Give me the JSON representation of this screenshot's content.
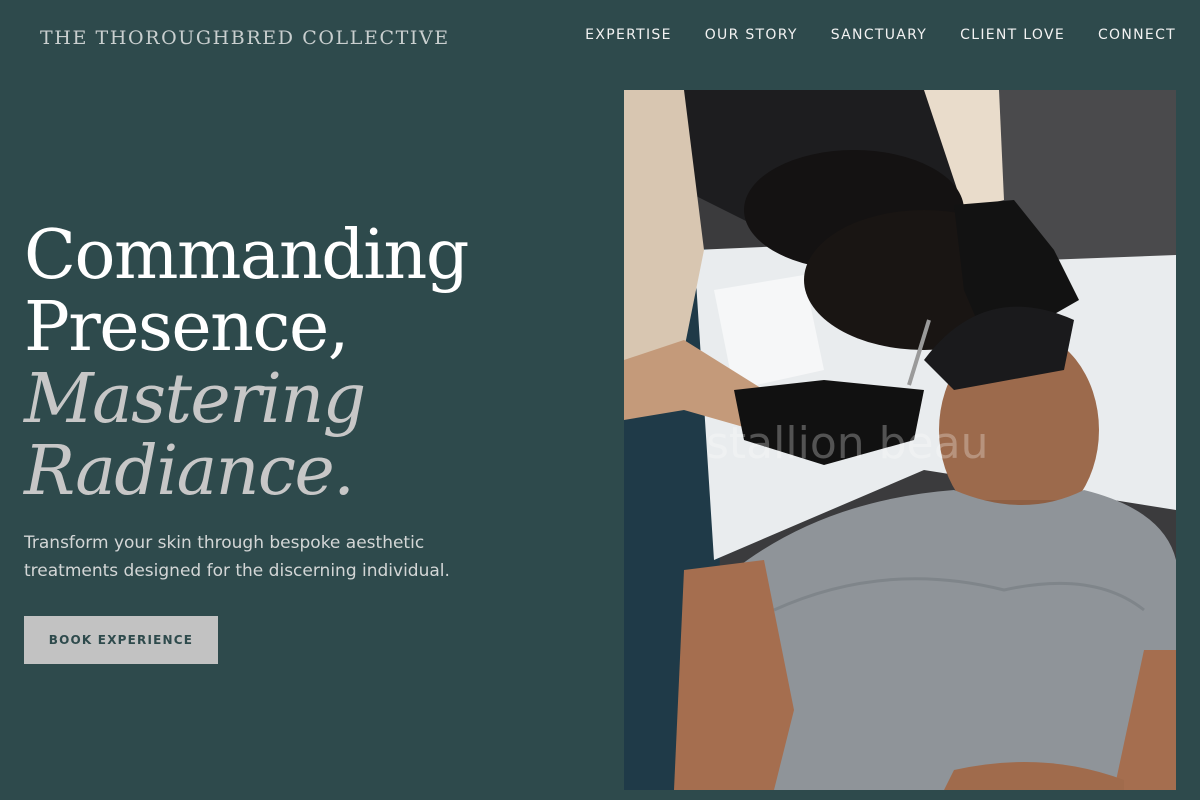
{
  "header": {
    "brand": "THE THOROUGHBRED COLLECTIVE",
    "nav": [
      "EXPERTISE",
      "OUR STORY",
      "SANCTUARY",
      "CLIENT LOVE",
      "CONNECT"
    ]
  },
  "hero": {
    "headline_line1": "Commanding",
    "headline_line2": "Presence,",
    "headline_line3": "Mastering",
    "headline_line4": "Radiance.",
    "subtitle": "Transform your skin through bespoke aesthetic treatments designed for the discerning individual.",
    "cta_label": "BOOK EXPERIENCE"
  },
  "photo": {
    "watermark": "stallion beau"
  },
  "colors": {
    "background": "#2e4a4c",
    "cta_bg": "#c2c2c2",
    "italic_text": "#c7c7c7"
  }
}
